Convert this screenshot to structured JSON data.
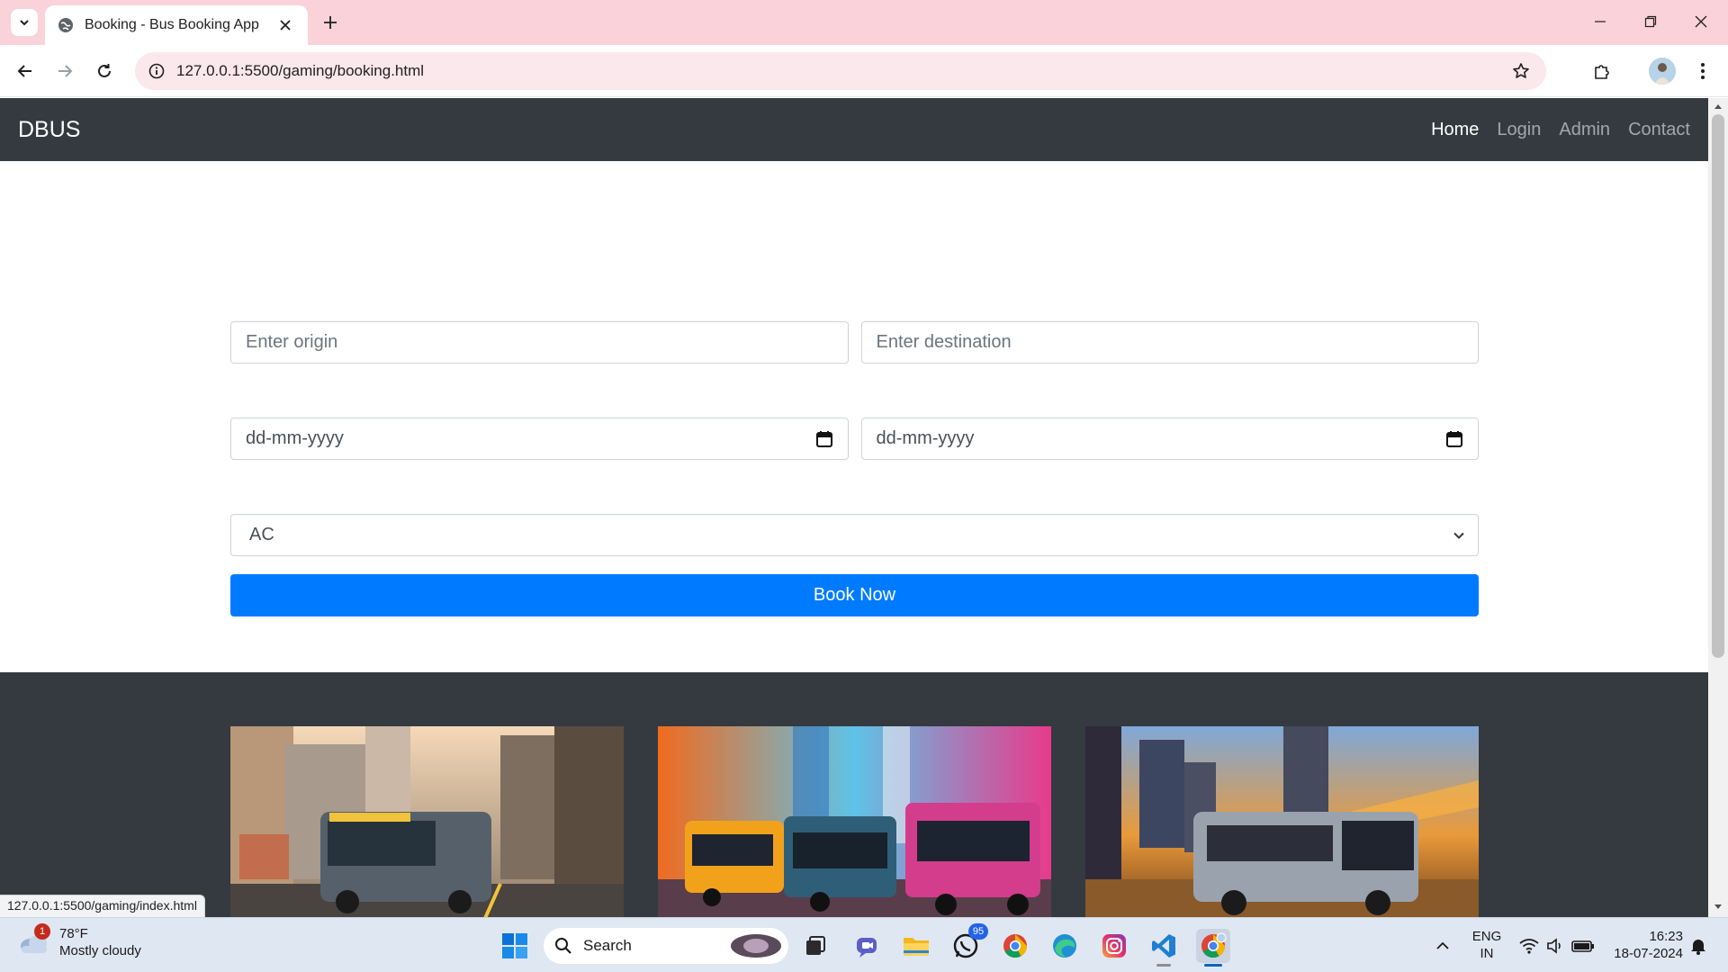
{
  "browser": {
    "tab_title": "Booking - Bus Booking App",
    "url": "127.0.0.1:5500/gaming/booking.html",
    "status_url": "127.0.0.1:5500/gaming/index.html"
  },
  "navbar": {
    "brand": "DBUS",
    "links": [
      {
        "label": "Home",
        "active": true
      },
      {
        "label": "Login",
        "active": false
      },
      {
        "label": "Admin",
        "active": false
      },
      {
        "label": "Contact",
        "active": false
      }
    ]
  },
  "form": {
    "origin_placeholder": "Enter origin",
    "destination_placeholder": "Enter destination",
    "date1_placeholder": "dd-mm-yyyy",
    "date2_placeholder": "dd-mm-yyyy",
    "bus_type_selected": "AC",
    "submit_label": "Book Now"
  },
  "taskbar": {
    "weather_badge": "1",
    "temperature": "78°F",
    "condition": "Mostly cloudy",
    "search_label": "Search",
    "whatsapp_badge": "95",
    "lang_line1": "ENG",
    "lang_line2": "IN",
    "time": "16:23",
    "date": "18-07-2024"
  },
  "colors": {
    "tabbar": "#fad2da",
    "navbar": "#343a40",
    "primary_button": "#007bff",
    "taskbar": "#dfe7f3"
  }
}
